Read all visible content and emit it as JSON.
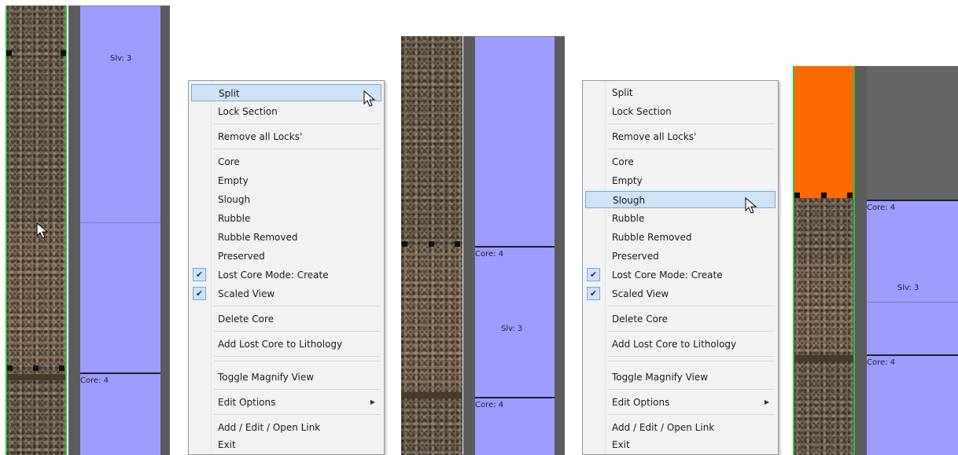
{
  "panel1": {
    "blocks": [
      {
        "label": "Slv: 3"
      },
      {
        "label": ""
      },
      {
        "label": "Core: 4"
      }
    ]
  },
  "menu1": {
    "items": [
      {
        "label": "Split",
        "highlighted": true
      },
      {
        "label": "Lock Section"
      },
      {
        "label": "Remove all Locks'"
      },
      {
        "label": "Core"
      },
      {
        "label": "Empty"
      },
      {
        "label": "Slough"
      },
      {
        "label": "Rubble"
      },
      {
        "label": "Rubble Removed"
      },
      {
        "label": "Preserved"
      },
      {
        "label": "Lost Core Mode: Create",
        "checked": true
      },
      {
        "label": "Scaled View",
        "checked": true
      },
      {
        "label": "Delete Core"
      },
      {
        "label": "Add Lost Core to Lithology"
      },
      {
        "label": "Toggle Magnify View"
      },
      {
        "label": "Edit Options",
        "submenu": true
      },
      {
        "label": "Add / Edit / Open Link"
      },
      {
        "label": "Exit"
      }
    ]
  },
  "panel2": {
    "blocks": [
      {
        "label": ""
      },
      {
        "label": "Core: 4",
        "sub": "Slv: 3"
      },
      {
        "label": "Core: 4"
      }
    ]
  },
  "menu2": {
    "items": [
      {
        "label": "Split"
      },
      {
        "label": "Lock Section"
      },
      {
        "label": "Remove all Locks'"
      },
      {
        "label": "Core"
      },
      {
        "label": "Empty"
      },
      {
        "label": "Slough",
        "highlighted": true
      },
      {
        "label": "Rubble"
      },
      {
        "label": "Rubble Removed"
      },
      {
        "label": "Preserved"
      },
      {
        "label": "Lost Core Mode: Create",
        "checked": true
      },
      {
        "label": "Scaled View",
        "checked": true
      },
      {
        "label": "Delete Core"
      },
      {
        "label": "Add Lost Core to Lithology"
      },
      {
        "label": "Toggle Magnify View"
      },
      {
        "label": "Edit Options",
        "submenu": true
      },
      {
        "label": "Add / Edit / Open Link"
      },
      {
        "label": "Exit"
      }
    ]
  },
  "panel3": {
    "blocks": [
      {
        "label": "Core: 4",
        "sub": "Slv: 3"
      },
      {
        "label": "Core: 4"
      }
    ]
  },
  "colors": {
    "block_fill": "#9d9dff",
    "slough_fill": "#ff6a00",
    "menu_highlight": "#cfe2f6",
    "boundary_line": "#29c23a"
  },
  "icons": {
    "checkmark": "check-icon",
    "submenu": "submenu-arrow-icon",
    "pointer": "cursor-icon"
  }
}
